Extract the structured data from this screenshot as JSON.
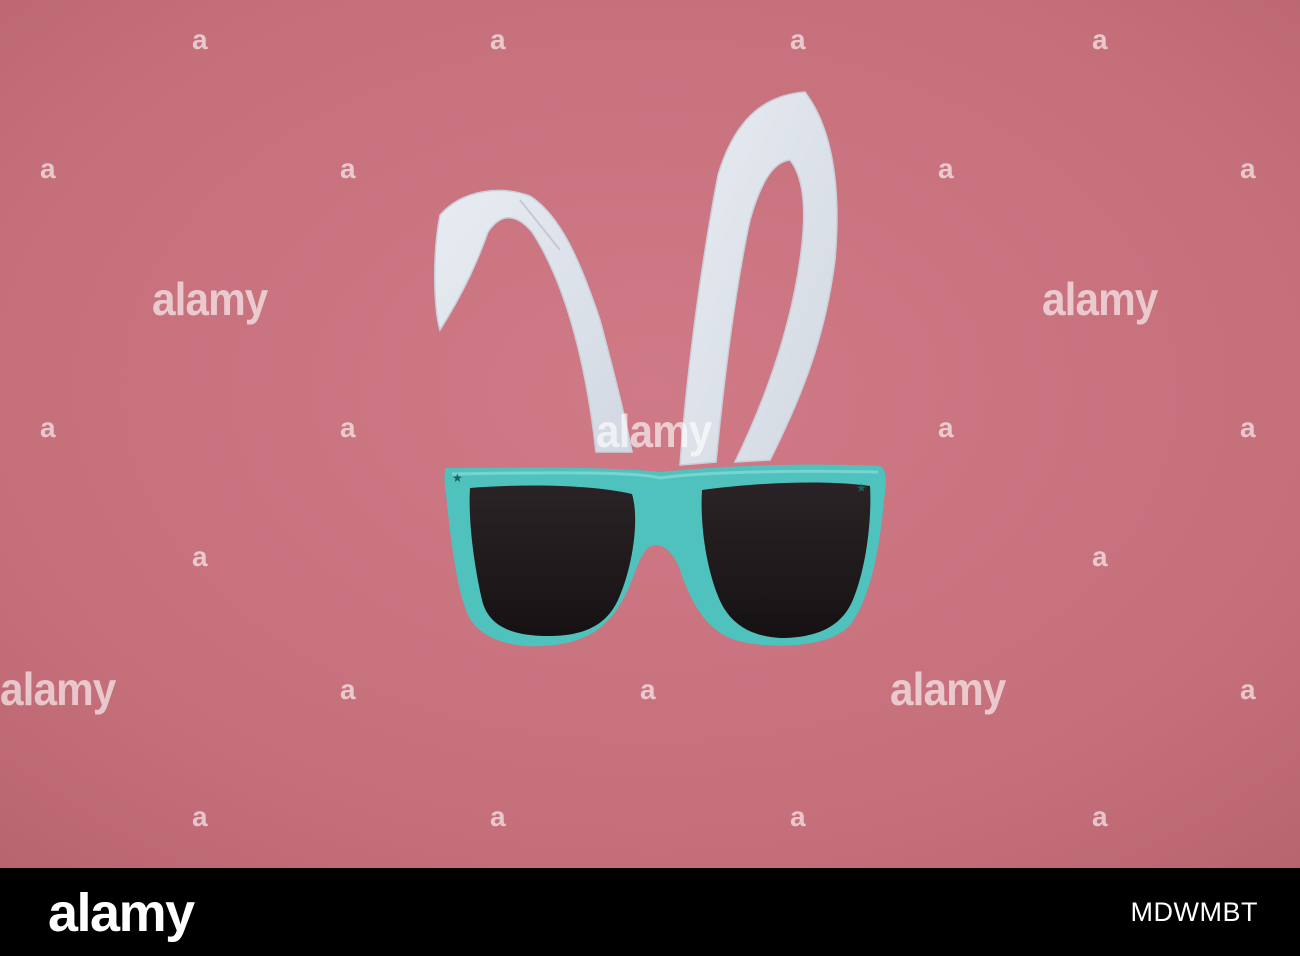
{
  "image": {
    "background_color": "#c9727e",
    "ear_color": "#dfe4ec",
    "frame_color": "#4fc2bd",
    "lens_color": "#1f1a1d",
    "footer_color": "#000000"
  },
  "watermark": {
    "logo_text": "alamy",
    "mark_symbol": "a"
  },
  "footer": {
    "logo_text": "alamy",
    "image_id": "MDWMBT"
  }
}
